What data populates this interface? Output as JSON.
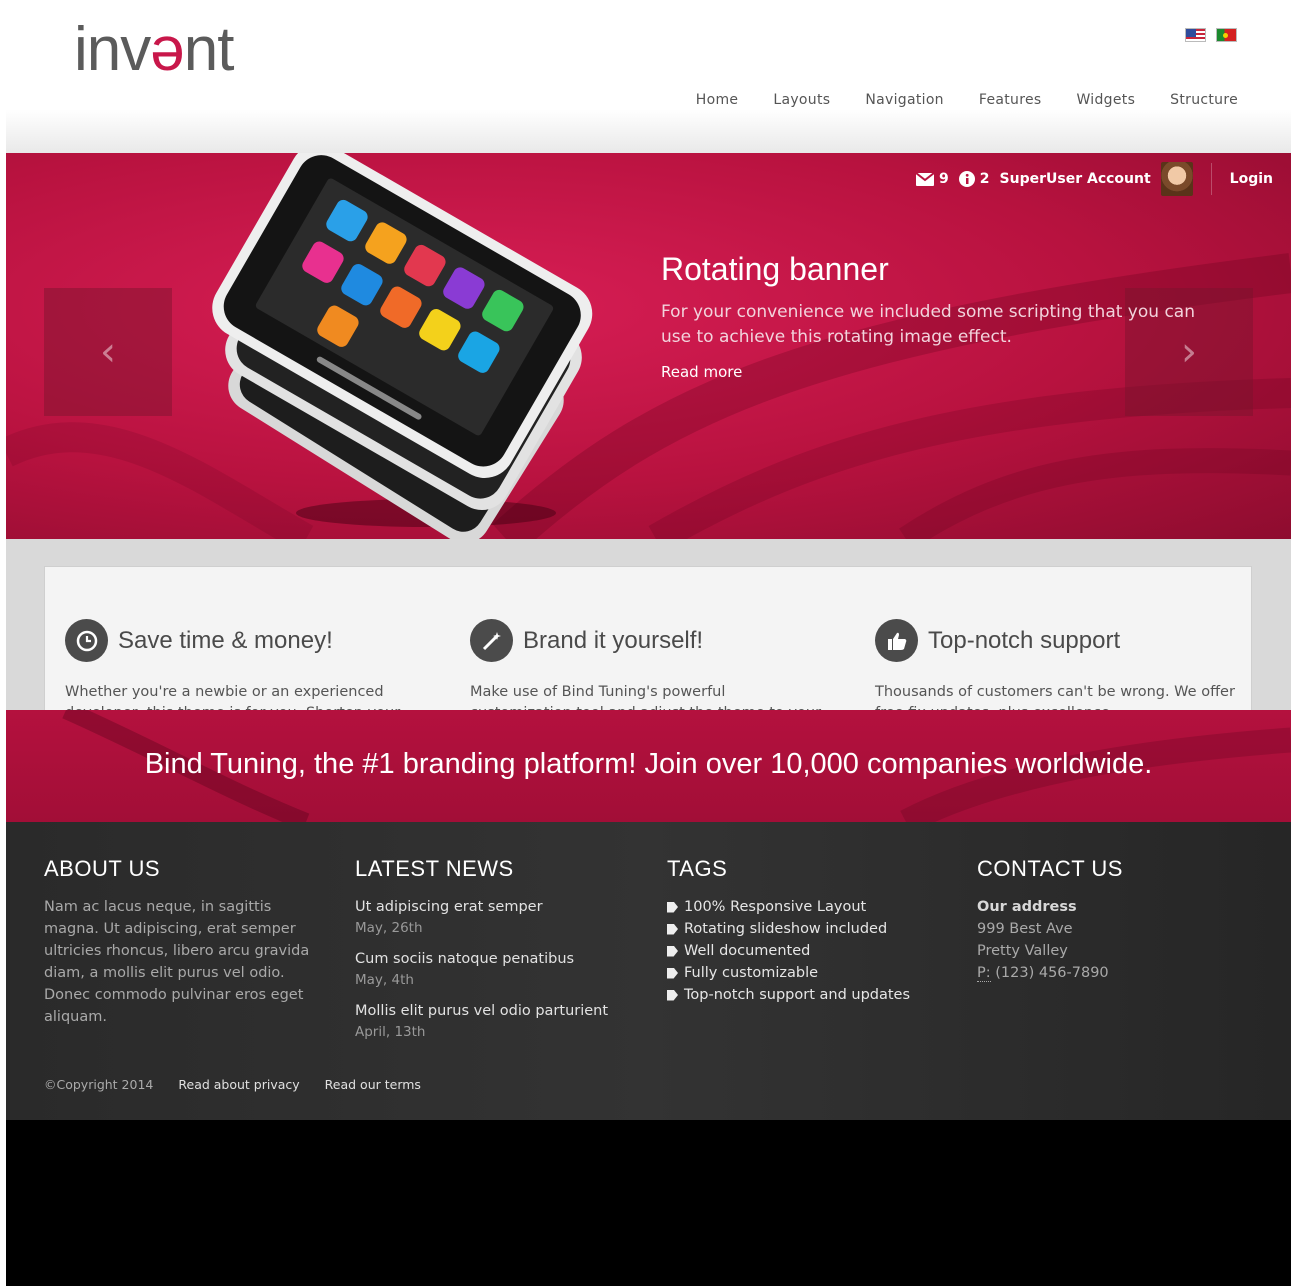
{
  "header": {
    "logo_prefix": "inv",
    "logo_accent": "ə",
    "logo_suffix": "nt",
    "flags": [
      "english-flag",
      "portuguese-flag"
    ],
    "nav": [
      "Home",
      "Layouts",
      "Navigation",
      "Features",
      "Widgets",
      "Structure"
    ]
  },
  "userbar": {
    "messages_count": "9",
    "notifications_count": "2",
    "account_label": "SuperUser Account",
    "login_label": "Login"
  },
  "banner": {
    "title": "Rotating banner",
    "description": "For your convenience we included some scripting that you can use to achieve this rotating image effect.",
    "read_more": "Read more",
    "prev_glyph": "‹",
    "next_glyph": "›"
  },
  "features": [
    {
      "icon": "clock-icon",
      "title": "Save time & money!",
      "text": "Whether you're a newbie or an experienced developer, this theme is for you. Shorten your"
    },
    {
      "icon": "magic-wand-icon",
      "title": "Brand it yourself!",
      "text": "Make use of Bind Tuning's powerful customization tool and adjust the theme to your"
    },
    {
      "icon": "thumbs-up-icon",
      "title": "Top-notch support",
      "text": "Thousands of customers can't be wrong. We offer free fix updates, plus excellence"
    }
  ],
  "cta": {
    "text": "Bind Tuning, the #1 branding platform! Join over 10,000 companies worldwide."
  },
  "footer": {
    "about": {
      "title": "ABOUT US",
      "text": "Nam ac lacus neque, in sagittis magna. Ut adipiscing, erat semper ultricies rhoncus, libero arcu gravida diam, a mollis elit purus vel odio. Donec commodo pulvinar eros eget aliquam."
    },
    "news": {
      "title": "LATEST NEWS",
      "items": [
        {
          "title": "Ut adipiscing erat semper",
          "date": "May, 26th"
        },
        {
          "title": "Cum sociis natoque penatibus",
          "date": "May, 4th"
        },
        {
          "title": "Mollis elit purus vel odio parturient",
          "date": "April, 13th"
        }
      ]
    },
    "tags": {
      "title": "TAGS",
      "items": [
        "100% Responsive Layout",
        "Rotating slideshow included",
        "Well documented",
        "Fully customizable",
        "Top-notch support and updates"
      ]
    },
    "contact": {
      "title": "CONTACT US",
      "address_title": "Our address",
      "street": "999 Best Ave",
      "city": "Pretty Valley",
      "phone_label": "P:",
      "phone": "(123) 456-7890"
    },
    "copyright": "©Copyright 2014",
    "privacy_link": "Read about privacy",
    "terms_link": "Read our terms"
  },
  "colors": {
    "brand": "#c8174a",
    "banner_bg": "#b8123f",
    "footer_bg": "#2e2e2e"
  }
}
